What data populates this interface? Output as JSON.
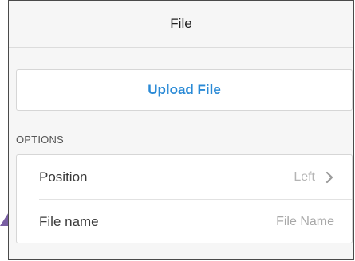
{
  "header": {
    "title": "File"
  },
  "upload": {
    "label": "Upload File"
  },
  "options": {
    "section_label": "OPTIONS",
    "position": {
      "label": "Position",
      "value": "Left"
    },
    "file_name": {
      "label": "File name",
      "placeholder": "File Name",
      "value": ""
    }
  },
  "colors": {
    "accent": "#2a8ad6",
    "panel_bg": "#f6f6f6",
    "corner_accent": "#7a5fa3"
  },
  "icons": {
    "position_chevron": "chevron-right-icon"
  }
}
